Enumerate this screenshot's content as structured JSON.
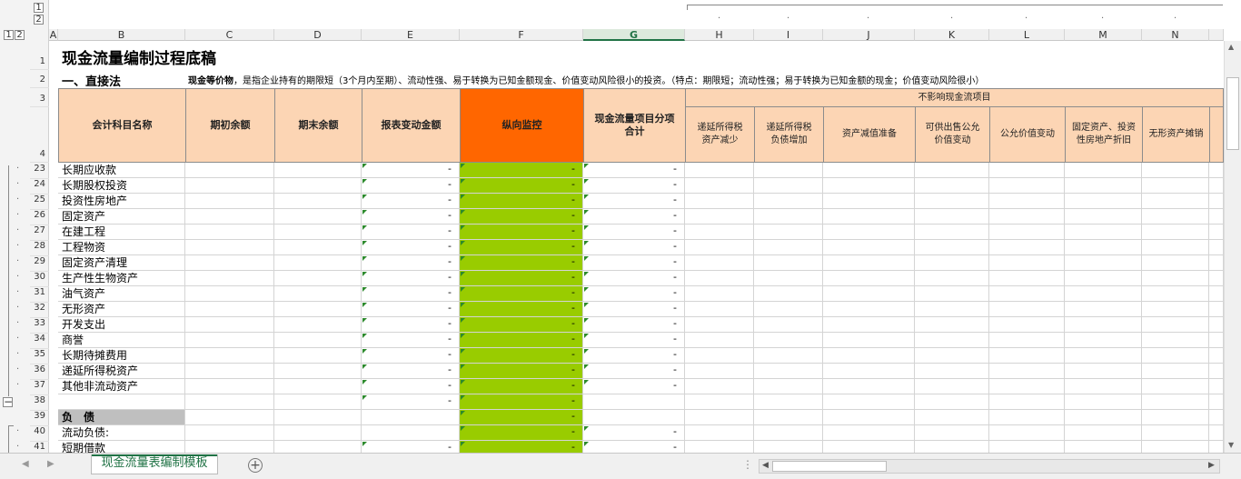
{
  "outline": {
    "row_levels": [
      "1",
      "2"
    ],
    "col_levels": [
      "1",
      "2"
    ]
  },
  "columns": [
    "A",
    "B",
    "C",
    "D",
    "E",
    "F",
    "G",
    "H",
    "I",
    "J",
    "K",
    "L",
    "M",
    "N"
  ],
  "title": "现金流量编制过程底稿",
  "section": "一、直接法",
  "note_label": "现金等价物",
  "note_text": "，是指企业持有的期限短（3个月内至期）、流动性强、易于转换为已知金额现金、价值变动风险很小的投资。（特点：期限短；流动性强；易于转换为已知金额的现金；价值变动风险很小）",
  "headers": {
    "b": "会计科目名称",
    "c": "期初余额",
    "d": "期末余额",
    "e": "报表变动金额",
    "f": "纵向监控",
    "g": "现金流量项目分项合计",
    "group": "不影响现金流项目",
    "h": "递延所得税资产减少",
    "i": "递延所得税负债增加",
    "j": "资产减值准备",
    "k": "可供出售公允价值变动",
    "l": "公允价值变动",
    "m": "固定资产、投资性房地产折旧",
    "n": "无形资产摊销"
  },
  "header_row_numbers": [
    "1",
    "2",
    "3",
    "4"
  ],
  "rows": [
    {
      "num": "23",
      "name": "长期应收款",
      "e": "-",
      "f": "-",
      "g": "-"
    },
    {
      "num": "24",
      "name": "长期股权投资",
      "e": "-",
      "f": "-",
      "g": "-"
    },
    {
      "num": "25",
      "name": "投资性房地产",
      "e": "-",
      "f": "-",
      "g": "-"
    },
    {
      "num": "26",
      "name": "固定资产",
      "e": "-",
      "f": "-",
      "g": "-"
    },
    {
      "num": "27",
      "name": "在建工程",
      "e": "-",
      "f": "-",
      "g": "-"
    },
    {
      "num": "28",
      "name": "工程物资",
      "e": "-",
      "f": "-",
      "g": "-"
    },
    {
      "num": "29",
      "name": "固定资产清理",
      "e": "-",
      "f": "-",
      "g": "-"
    },
    {
      "num": "30",
      "name": "生产性生物资产",
      "e": "-",
      "f": "-",
      "g": "-"
    },
    {
      "num": "31",
      "name": "油气资产",
      "e": "-",
      "f": "-",
      "g": "-"
    },
    {
      "num": "32",
      "name": "无形资产",
      "e": "-",
      "f": "-",
      "g": "-"
    },
    {
      "num": "33",
      "name": "开发支出",
      "e": "-",
      "f": "-",
      "g": "-"
    },
    {
      "num": "34",
      "name": "商誉",
      "e": "-",
      "f": "-",
      "g": "-"
    },
    {
      "num": "35",
      "name": "长期待摊费用",
      "e": "-",
      "f": "-",
      "g": "-"
    },
    {
      "num": "36",
      "name": "递延所得税资产",
      "e": "-",
      "f": "-",
      "g": "-"
    },
    {
      "num": "37",
      "name": "其他非流动资产",
      "e": "-",
      "f": "-",
      "g": "-"
    },
    {
      "num": "38",
      "name": "",
      "e": "-",
      "f": "-",
      "g": ""
    },
    {
      "num": "39",
      "name": "负　债",
      "e": "",
      "f": "-",
      "g": "",
      "shaded": true
    },
    {
      "num": "40",
      "name": "流动负债:",
      "e": "",
      "f": "-",
      "g": "-"
    },
    {
      "num": "41",
      "name": "短期借款",
      "e": "-",
      "f": "-",
      "g": "-"
    }
  ],
  "sheet_tab": "现金流量表编制模板",
  "colors": {
    "header_fill": "#fcd5b4",
    "monitor_fill": "#ff6600",
    "green_fill": "#99cc00",
    "accent": "#217346"
  }
}
